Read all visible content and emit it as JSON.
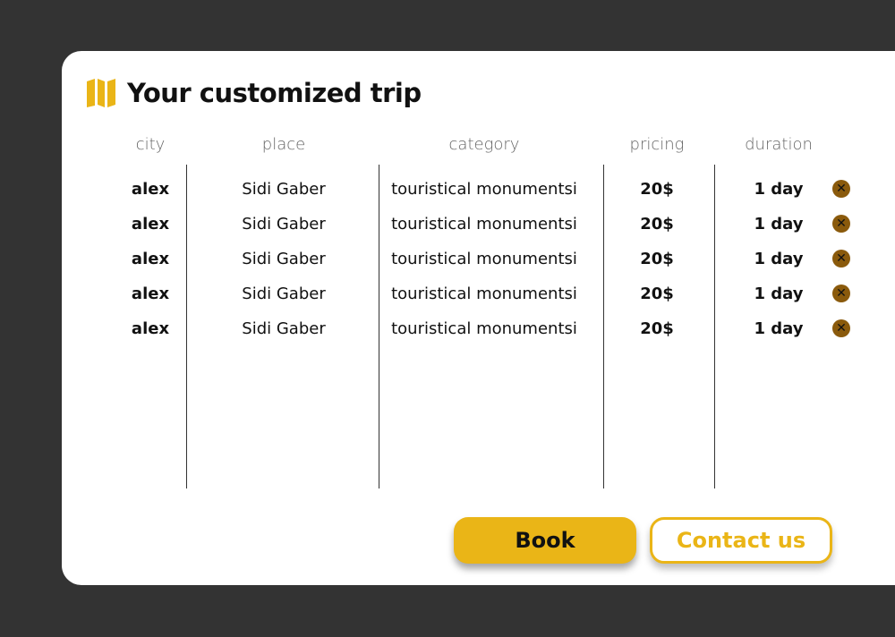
{
  "title": "Your customized trip",
  "colors": {
    "accent": "#eab517",
    "remove": "#8a5a0c",
    "background": "#333333"
  },
  "table": {
    "headers": [
      "city",
      "place",
      "category",
      "pricing",
      "duration"
    ],
    "rows": [
      {
        "city": "alex",
        "place": "Sidi Gaber",
        "category": "touristical monumentsi",
        "pricing": "20$",
        "duration": "1 day"
      },
      {
        "city": "alex",
        "place": "Sidi Gaber",
        "category": "touristical monumentsi",
        "pricing": "20$",
        "duration": "1 day"
      },
      {
        "city": "alex",
        "place": "Sidi Gaber",
        "category": "touristical monumentsi",
        "pricing": "20$",
        "duration": "1 day"
      },
      {
        "city": "alex",
        "place": "Sidi Gaber",
        "category": "touristical monumentsi",
        "pricing": "20$",
        "duration": "1 day"
      },
      {
        "city": "alex",
        "place": "Sidi Gaber",
        "category": "touristical monumentsi",
        "pricing": "20$",
        "duration": "1 day"
      }
    ],
    "remove_icon": "close-circle-icon",
    "remove_glyph": "✕"
  },
  "buttons": {
    "book": "Book",
    "contact": "Contact us"
  }
}
